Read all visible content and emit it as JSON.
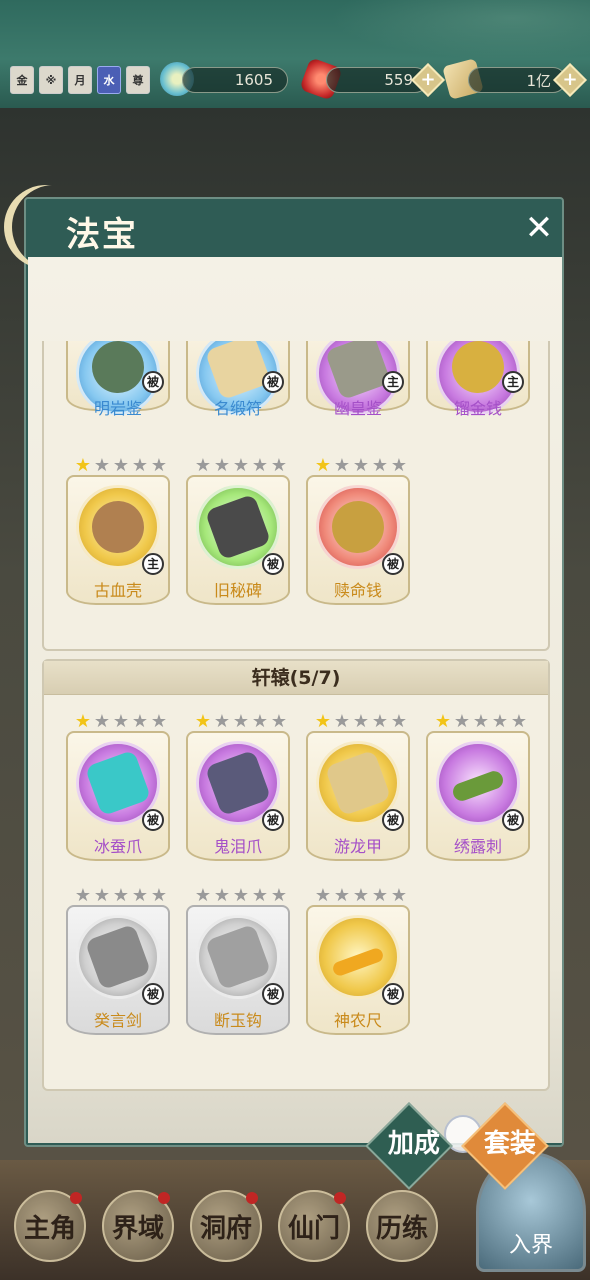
{
  "header": {
    "tags": [
      "金",
      "※",
      "月",
      "水",
      "尊"
    ],
    "resources": [
      {
        "icon": "swirl-icon",
        "value": "1605"
      },
      {
        "icon": "red-gem-icon",
        "value": "559"
      },
      {
        "icon": "scroll-icon",
        "value": "1亿"
      }
    ]
  },
  "panel": {
    "title": "法宝",
    "close": "✕",
    "top_items": [
      {
        "name": "明岩鉴",
        "badge": "被",
        "stars": 0,
        "color": "blue"
      },
      {
        "name": "名缎符",
        "badge": "被",
        "stars": 0,
        "color": "blue"
      },
      {
        "name": "幽皇鉴",
        "badge": "主",
        "stars": 0,
        "color": "purple"
      },
      {
        "name": "镏金钱",
        "badge": "主",
        "stars": 0,
        "color": "purple"
      },
      {
        "name": "古血壳",
        "badge": "主",
        "stars": 1,
        "color": "gold"
      },
      {
        "name": "旧秘碑",
        "badge": "被",
        "stars": 0,
        "color": "gold"
      },
      {
        "name": "赎命钱",
        "badge": "被",
        "stars": 1,
        "color": "gold"
      }
    ],
    "set_section": {
      "title": "轩辕(5/7)",
      "items": [
        {
          "name": "冰蚕爪",
          "badge": "被",
          "stars": 1,
          "color": "purple"
        },
        {
          "name": "鬼泪爪",
          "badge": "被",
          "stars": 1,
          "color": "purple"
        },
        {
          "name": "游龙甲",
          "badge": "被",
          "stars": 1,
          "color": "gold"
        },
        {
          "name": "绣露刺",
          "badge": "被",
          "stars": 1,
          "color": "purple"
        },
        {
          "name": "癸言剑",
          "badge": "被",
          "stars": 0,
          "color": "gold"
        },
        {
          "name": "断玉钩",
          "badge": "被",
          "stars": 0,
          "color": "gold"
        },
        {
          "name": "神农尺",
          "badge": "被",
          "stars": 0,
          "color": "gold"
        }
      ]
    },
    "bonus_button": "加成",
    "set_button": "套装"
  },
  "bottom_nav": {
    "items": [
      "主角",
      "界域",
      "洞府",
      "仙门",
      "历练"
    ],
    "enter": "入界"
  }
}
